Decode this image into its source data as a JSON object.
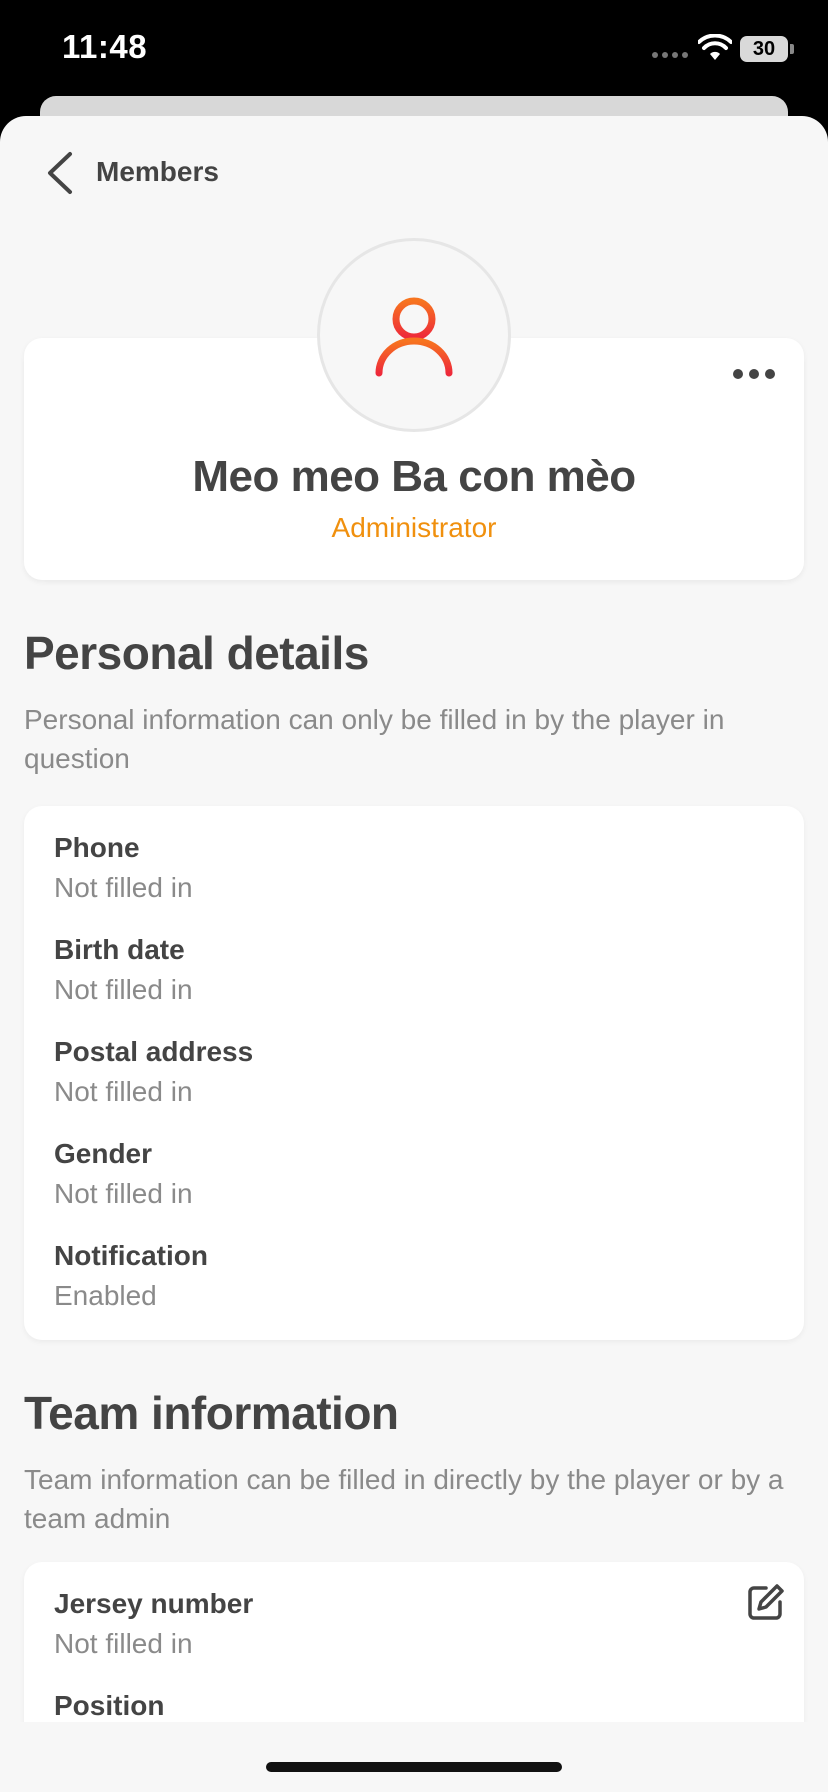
{
  "status_bar": {
    "time": "11:48",
    "battery": "30"
  },
  "nav": {
    "back_label": "Members"
  },
  "profile": {
    "name": "Meo meo Ba con mèo",
    "role": "Administrator"
  },
  "personal": {
    "title": "Personal details",
    "description": "Personal information can only be filled in by the player in question",
    "fields": [
      {
        "label": "Phone",
        "value": "Not filled in"
      },
      {
        "label": "Birth date",
        "value": "Not filled in"
      },
      {
        "label": "Postal address",
        "value": "Not filled in"
      },
      {
        "label": "Gender",
        "value": "Not filled in"
      },
      {
        "label": "Notification",
        "value": "Enabled"
      }
    ]
  },
  "team": {
    "title": "Team information",
    "description": "Team information can be filled in directly by the player or by a team admin",
    "fields": [
      {
        "label": "Jersey number",
        "value": "Not filled in"
      },
      {
        "label": "Position",
        "value": ""
      }
    ]
  },
  "colors": {
    "accent": "#f0900e",
    "avatar_gradient_top": "#f7741f",
    "avatar_gradient_bottom": "#ee2a3a"
  },
  "icons": {
    "back": "chevron-left-icon",
    "more": "more-horizontal-icon",
    "edit": "edit-icon",
    "avatar": "user-icon"
  }
}
